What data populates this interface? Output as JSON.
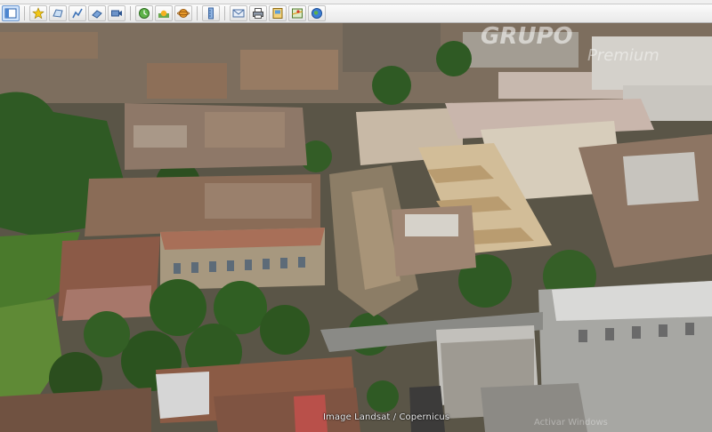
{
  "toolbar": {
    "buttons": [
      {
        "name": "sidebar-toggle",
        "icon": "sidebar-icon",
        "active": true
      },
      {
        "name": "add-placemark",
        "icon": "pushpin-icon"
      },
      {
        "name": "add-polygon",
        "icon": "polygon-icon"
      },
      {
        "name": "add-path",
        "icon": "path-icon"
      },
      {
        "name": "add-image-overlay",
        "icon": "image-overlay-icon"
      },
      {
        "name": "record-tour",
        "icon": "record-tour-icon"
      },
      {
        "name": "historical-imagery",
        "icon": "clock-icon"
      },
      {
        "name": "sunlight",
        "icon": "sun-icon"
      },
      {
        "name": "switch-to-sky",
        "icon": "planet-icon"
      },
      {
        "name": "ruler",
        "icon": "ruler-icon"
      },
      {
        "name": "email",
        "icon": "email-icon"
      },
      {
        "name": "print",
        "icon": "print-icon"
      },
      {
        "name": "save-image",
        "icon": "save-image-icon"
      },
      {
        "name": "view-in-maps",
        "icon": "maps-icon"
      },
      {
        "name": "earth-gallery",
        "icon": "globe-icon"
      }
    ]
  },
  "viewport": {
    "attribution": "Image Landsat / Copernicus",
    "watermark_title": "GRUPO",
    "watermark_subtitle": "Premium",
    "watermark_bottom": "Activar Windows"
  },
  "colors": {
    "toolbar_bg": "#ececec",
    "active_button": "#cfe3fb",
    "roof_rust": "#8a5a44",
    "roof_metal": "#b9b2a4",
    "vegetation": "#2f5a24"
  }
}
